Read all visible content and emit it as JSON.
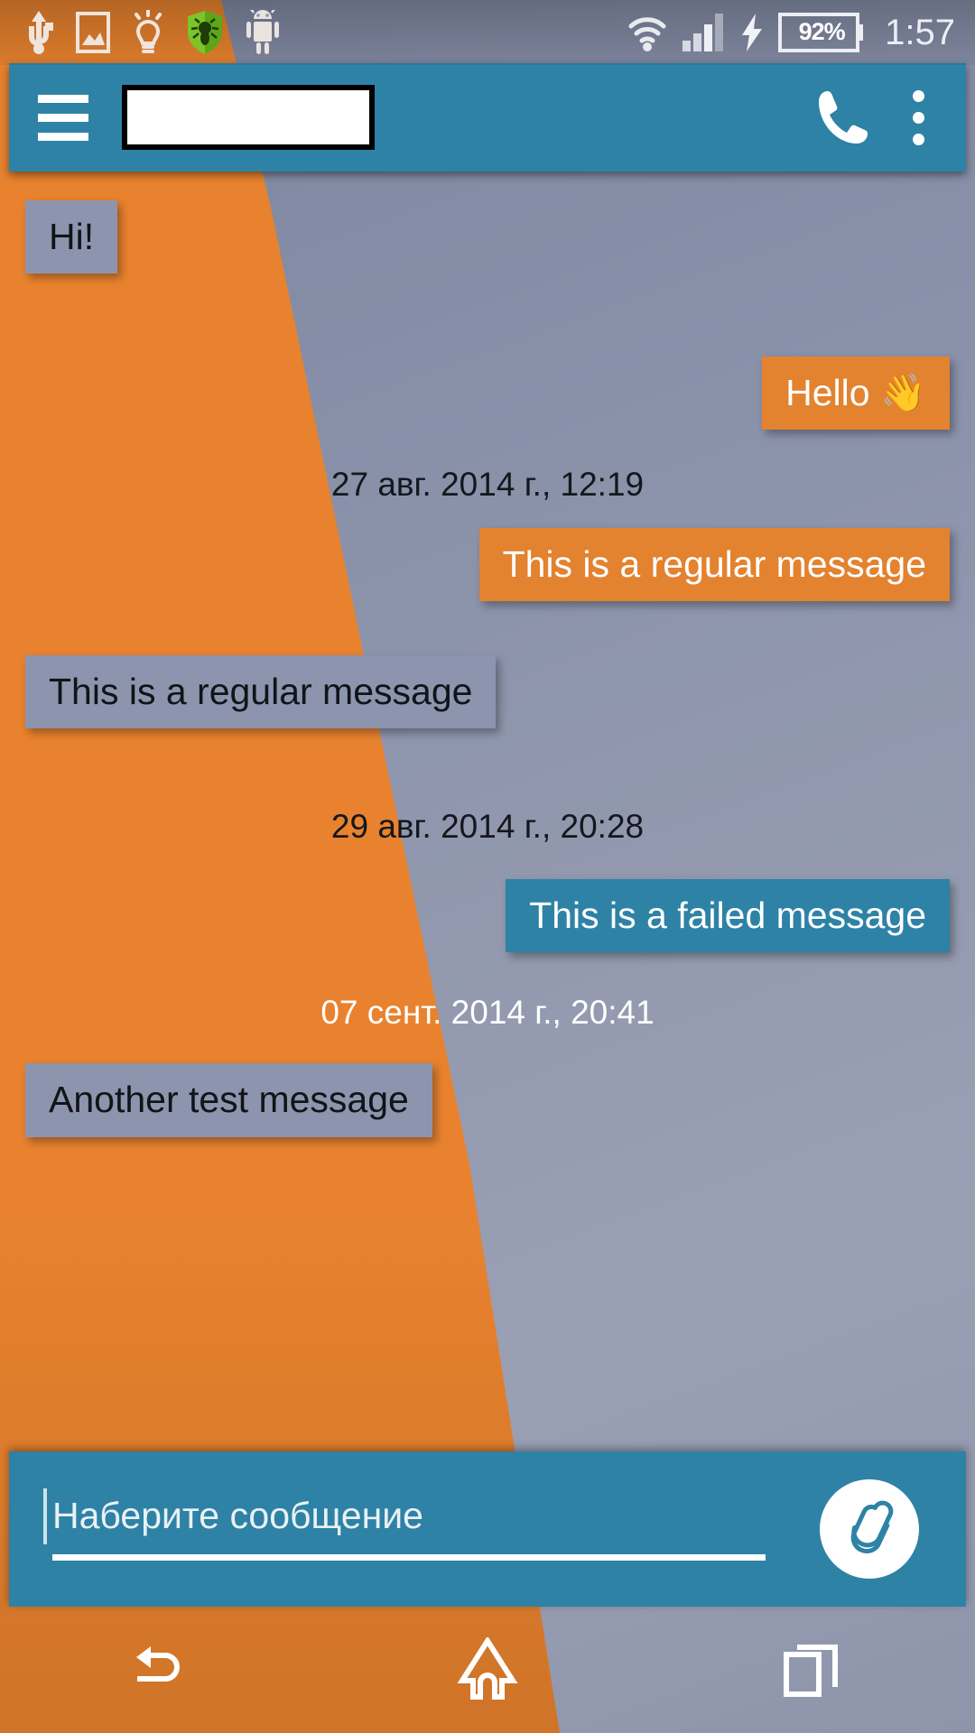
{
  "statusbar": {
    "left_icons": [
      {
        "name": "usb-icon",
        "label": "USB connected"
      },
      {
        "name": "screenshot-image-icon",
        "label": "Screenshot saved"
      },
      {
        "name": "lightbulb-icon",
        "label": "Flashlight"
      },
      {
        "name": "drweb-shield-icon",
        "label": "Dr.Web"
      },
      {
        "name": "android-robot-icon",
        "label": "Android system"
      }
    ],
    "right_icons": [
      {
        "name": "wifi-icon",
        "label": "Wi-Fi"
      },
      {
        "name": "signal-bars-icon",
        "label": "Mobile signal"
      },
      {
        "name": "charging-bolt-icon",
        "label": "Charging"
      }
    ],
    "battery_percent": "92%",
    "clock": "1:57"
  },
  "appbar": {
    "menu_label": "Menu",
    "title": "",
    "title_redacted": true,
    "call_label": "Call",
    "overflow_label": "More options",
    "background_color": "#2e82a6"
  },
  "conversation": [
    {
      "kind": "message",
      "direction": "incoming",
      "status": "received",
      "text": "Hi!"
    },
    {
      "kind": "message",
      "direction": "outgoing",
      "status": "sent",
      "text": "Hello 👋"
    },
    {
      "kind": "date",
      "style": "dark",
      "text": "27 авг. 2014 г., 12:19"
    },
    {
      "kind": "message",
      "direction": "outgoing",
      "status": "sent",
      "text": "This is a regular message"
    },
    {
      "kind": "message",
      "direction": "incoming",
      "status": "received",
      "text": "This is a regular message"
    },
    {
      "kind": "date",
      "style": "dark",
      "text": "29 авг. 2014 г., 20:28"
    },
    {
      "kind": "message",
      "direction": "outgoing",
      "status": "failed",
      "text": "This is a failed message"
    },
    {
      "kind": "date",
      "style": "light",
      "text": "07 сент. 2014 г., 20:41"
    },
    {
      "kind": "message",
      "direction": "incoming",
      "status": "received",
      "text": "Another test message"
    }
  ],
  "compose": {
    "placeholder": "Наберите сообщение",
    "value": "",
    "attach_label": "Attach"
  },
  "navbar": {
    "back_label": "Back",
    "home_label": "Home",
    "recents_label": "Recent apps"
  },
  "colors": {
    "accent_teal": "#2e82a6",
    "accent_orange": "#e3822f",
    "incoming_bubble": "#8d95ae",
    "wallpaper_orange": "#e8822e",
    "wallpaper_gray": "#8b93ab"
  }
}
